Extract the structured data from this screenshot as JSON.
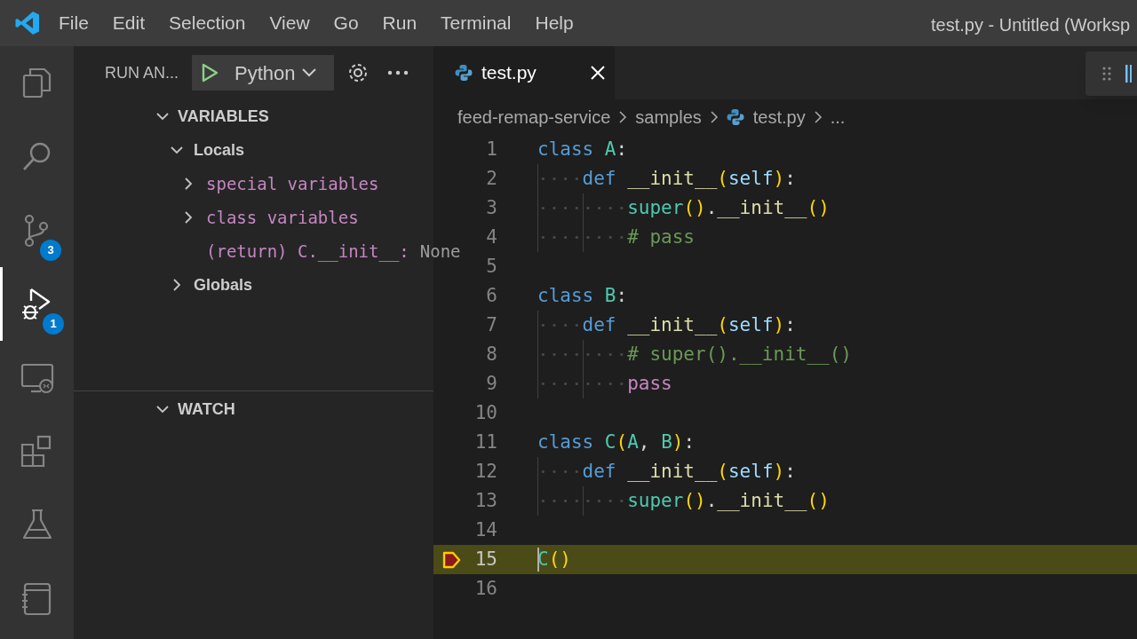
{
  "title_bar": {
    "menu": [
      "File",
      "Edit",
      "Selection",
      "View",
      "Go",
      "Run",
      "Terminal",
      "Help"
    ],
    "title": "test.py - Untitled (Worksp"
  },
  "activity_bar": [
    {
      "kind": "files",
      "selected": false
    },
    {
      "kind": "search",
      "selected": false
    },
    {
      "kind": "source-control",
      "selected": false,
      "badge": "3"
    },
    {
      "kind": "run-debug",
      "selected": true,
      "badge": "1"
    },
    {
      "kind": "remote",
      "selected": false
    },
    {
      "kind": "extensions",
      "selected": false
    },
    {
      "kind": "testing",
      "selected": false
    },
    {
      "kind": "notebook",
      "selected": false
    }
  ],
  "sidebar": {
    "title": "RUN AN...",
    "configuration": "Python",
    "sections": [
      {
        "title": "VARIABLES",
        "expanded": true,
        "children": [
          {
            "label": "Locals",
            "expanded": true,
            "children": [
              {
                "kind": "group",
                "name": "special variables",
                "expanded": false
              },
              {
                "kind": "group",
                "name": "class variables",
                "expanded": false
              },
              {
                "kind": "value",
                "name": "(return) C.__init__:",
                "value": "None"
              }
            ]
          },
          {
            "label": "Globals",
            "expanded": false
          }
        ]
      },
      {
        "title": "WATCH",
        "expanded": true
      }
    ]
  },
  "editor": {
    "tabs": [
      {
        "label": "test.py",
        "selected": true
      }
    ],
    "breadcrumbs": [
      {
        "kind": "folder",
        "label": "feed-remap-service"
      },
      {
        "kind": "folder",
        "label": "samples"
      },
      {
        "kind": "file",
        "label": "test.py"
      },
      {
        "kind": "more",
        "label": "..."
      }
    ],
    "lines": [
      {
        "number": "1",
        "current": false,
        "tokens": [
          {
            "kind": "keyword",
            "text": "class "
          },
          {
            "kind": "class",
            "text": "A"
          },
          {
            "kind": "plain",
            "text": ":"
          }
        ]
      },
      {
        "number": "2",
        "current": false,
        "tokens": [
          {
            "kind": "keyword",
            "text": "    def "
          },
          {
            "kind": "func",
            "text": "__init__"
          },
          {
            "kind": "paren",
            "text": "("
          },
          {
            "kind": "param",
            "text": "self"
          },
          {
            "kind": "paren",
            "text": ")"
          },
          {
            "kind": "plain",
            "text": ":"
          }
        ]
      },
      {
        "number": "3",
        "current": false,
        "tokens": [
          {
            "kind": "class",
            "text": "        super"
          },
          {
            "kind": "paren",
            "text": "()"
          },
          {
            "kind": "plain",
            "text": "."
          },
          {
            "kind": "func",
            "text": "__init__"
          },
          {
            "kind": "paren",
            "text": "()"
          }
        ]
      },
      {
        "number": "4",
        "current": false,
        "tokens": [
          {
            "kind": "comment",
            "text": "        # pass"
          }
        ]
      },
      {
        "number": "5",
        "current": false
      },
      {
        "number": "6",
        "current": false,
        "tokens": [
          {
            "kind": "keyword",
            "text": "class "
          },
          {
            "kind": "class",
            "text": "B"
          },
          {
            "kind": "plain",
            "text": ":"
          }
        ]
      },
      {
        "number": "7",
        "current": false,
        "tokens": [
          {
            "kind": "keyword",
            "text": "    def "
          },
          {
            "kind": "func",
            "text": "__init__"
          },
          {
            "kind": "paren",
            "text": "("
          },
          {
            "kind": "param",
            "text": "self"
          },
          {
            "kind": "paren",
            "text": ")"
          },
          {
            "kind": "plain",
            "text": ":"
          }
        ]
      },
      {
        "number": "8",
        "current": false,
        "tokens": [
          {
            "kind": "comment",
            "text": "        # super().__init__()"
          }
        ]
      },
      {
        "number": "9",
        "current": false,
        "tokens": [
          {
            "kind": "control",
            "text": "        pass"
          }
        ]
      },
      {
        "number": "10",
        "current": false
      },
      {
        "number": "11",
        "current": false,
        "tokens": [
          {
            "kind": "keyword",
            "text": "class "
          },
          {
            "kind": "class",
            "text": "C"
          },
          {
            "kind": "paren",
            "text": "("
          },
          {
            "kind": "class",
            "text": "A"
          },
          {
            "kind": "plain",
            "text": ", "
          },
          {
            "kind": "class",
            "text": "B"
          },
          {
            "kind": "paren",
            "text": ")"
          },
          {
            "kind": "plain",
            "text": ":"
          }
        ]
      },
      {
        "number": "12",
        "current": false,
        "tokens": [
          {
            "kind": "keyword",
            "text": "    def "
          },
          {
            "kind": "func",
            "text": "__init__"
          },
          {
            "kind": "paren",
            "text": "("
          },
          {
            "kind": "param",
            "text": "self"
          },
          {
            "kind": "paren",
            "text": ")"
          },
          {
            "kind": "plain",
            "text": ":"
          }
        ]
      },
      {
        "number": "13",
        "current": false,
        "tokens": [
          {
            "kind": "class",
            "text": "        super"
          },
          {
            "kind": "paren",
            "text": "()"
          },
          {
            "kind": "plain",
            "text": "."
          },
          {
            "kind": "func",
            "text": "__init__"
          },
          {
            "kind": "paren",
            "text": "()"
          }
        ]
      },
      {
        "number": "14",
        "current": false
      },
      {
        "number": "15",
        "current": true,
        "tokens": [
          {
            "kind": "class",
            "text": "C"
          },
          {
            "kind": "paren",
            "text": "()"
          }
        ]
      },
      {
        "number": "16",
        "current": false
      }
    ]
  }
}
